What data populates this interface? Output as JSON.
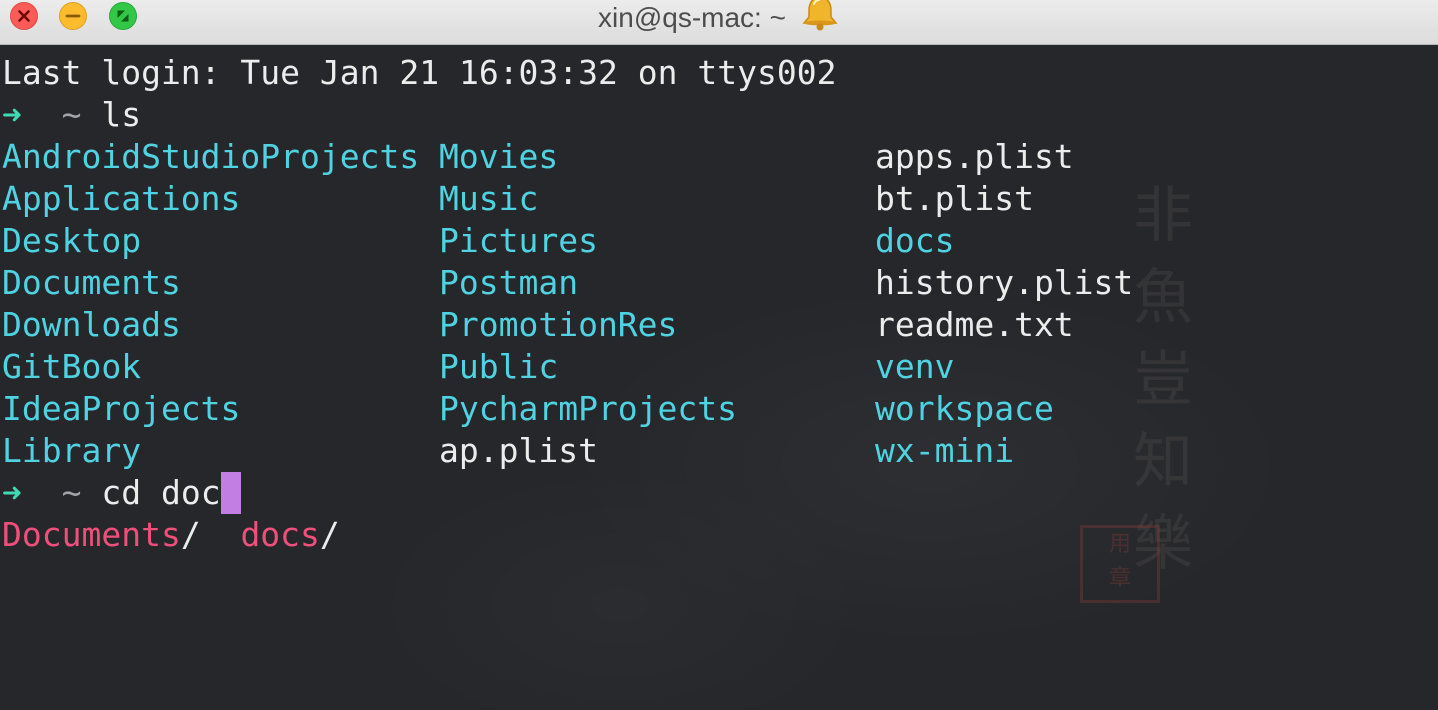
{
  "window": {
    "title": "xin@qs-mac: ~",
    "title_icon": "bell-icon"
  },
  "colors": {
    "background": "#26272b",
    "directory": "#4fd3e2",
    "file": "#ececec",
    "prompt_arrow": "#3fd9b4",
    "completion": "#f14f7b",
    "cursor": "#c37ee3"
  },
  "terminal": {
    "last_login": "Last login: Tue Jan 21 16:03:32 on ttys002",
    "prompt1": {
      "arrow": "➜",
      "cwd": "~",
      "command": "ls"
    },
    "ls_rows": [
      [
        {
          "name": "AndroidStudioProjects",
          "kind": "dir"
        },
        {
          "name": "Movies",
          "kind": "dir"
        },
        {
          "name": "apps.plist",
          "kind": "file"
        }
      ],
      [
        {
          "name": "Applications",
          "kind": "dir"
        },
        {
          "name": "Music",
          "kind": "dir"
        },
        {
          "name": "bt.plist",
          "kind": "file"
        }
      ],
      [
        {
          "name": "Desktop",
          "kind": "dir"
        },
        {
          "name": "Pictures",
          "kind": "dir"
        },
        {
          "name": "docs",
          "kind": "dir"
        }
      ],
      [
        {
          "name": "Documents",
          "kind": "dir"
        },
        {
          "name": "Postman",
          "kind": "dir"
        },
        {
          "name": "history.plist",
          "kind": "file"
        }
      ],
      [
        {
          "name": "Downloads",
          "kind": "dir"
        },
        {
          "name": "PromotionRes",
          "kind": "dir"
        },
        {
          "name": "readme.txt",
          "kind": "file"
        }
      ],
      [
        {
          "name": "GitBook",
          "kind": "dir"
        },
        {
          "name": "Public",
          "kind": "dir"
        },
        {
          "name": "venv",
          "kind": "dir"
        }
      ],
      [
        {
          "name": "IdeaProjects",
          "kind": "dir"
        },
        {
          "name": "PycharmProjects",
          "kind": "dir"
        },
        {
          "name": "workspace",
          "kind": "dir"
        }
      ],
      [
        {
          "name": "Library",
          "kind": "dir"
        },
        {
          "name": "ap.plist",
          "kind": "file"
        },
        {
          "name": "wx-mini",
          "kind": "dir"
        }
      ]
    ],
    "prompt2": {
      "arrow": "➜",
      "cwd": "~",
      "command": "cd doc"
    },
    "completions": [
      {
        "name": "Documents",
        "suffix": "/"
      },
      {
        "name": "docs",
        "suffix": "/"
      }
    ]
  },
  "background_art": {
    "calligraphy": [
      "非",
      "魚",
      "豈",
      "知",
      "樂"
    ],
    "seal": [
      "用",
      "章"
    ]
  }
}
